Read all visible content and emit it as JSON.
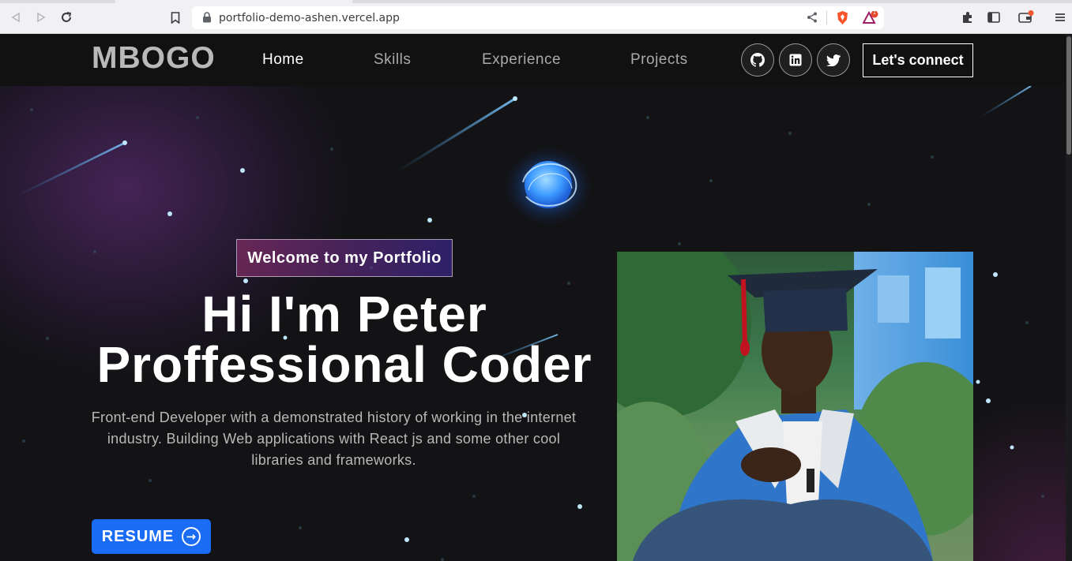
{
  "browser": {
    "url": "portfolio-demo-ashen.vercel.app",
    "shield_badge": "1"
  },
  "navbar": {
    "logo": "MBOGO",
    "links": [
      "Home",
      "Skills",
      "Experience",
      "Projects"
    ],
    "social": [
      "github-icon",
      "linkedin-icon",
      "twitter-icon"
    ],
    "cta": "Let's connect"
  },
  "hero": {
    "tagline": "Welcome to my Portfolio",
    "headline_line1": "Hi I'm Peter",
    "headline_line2": "Proffessional Coder",
    "intro": "Front-end Developer with a demonstrated history of working in the internet industry. Building Web applications with React js and some other cool libraries and frameworks.",
    "resume_label": "RESUME"
  },
  "colors": {
    "accent_blue": "#1a6cf5",
    "background": "#131315",
    "tagline_gradient": [
      "#aa367c",
      "#4a2fbd"
    ]
  }
}
